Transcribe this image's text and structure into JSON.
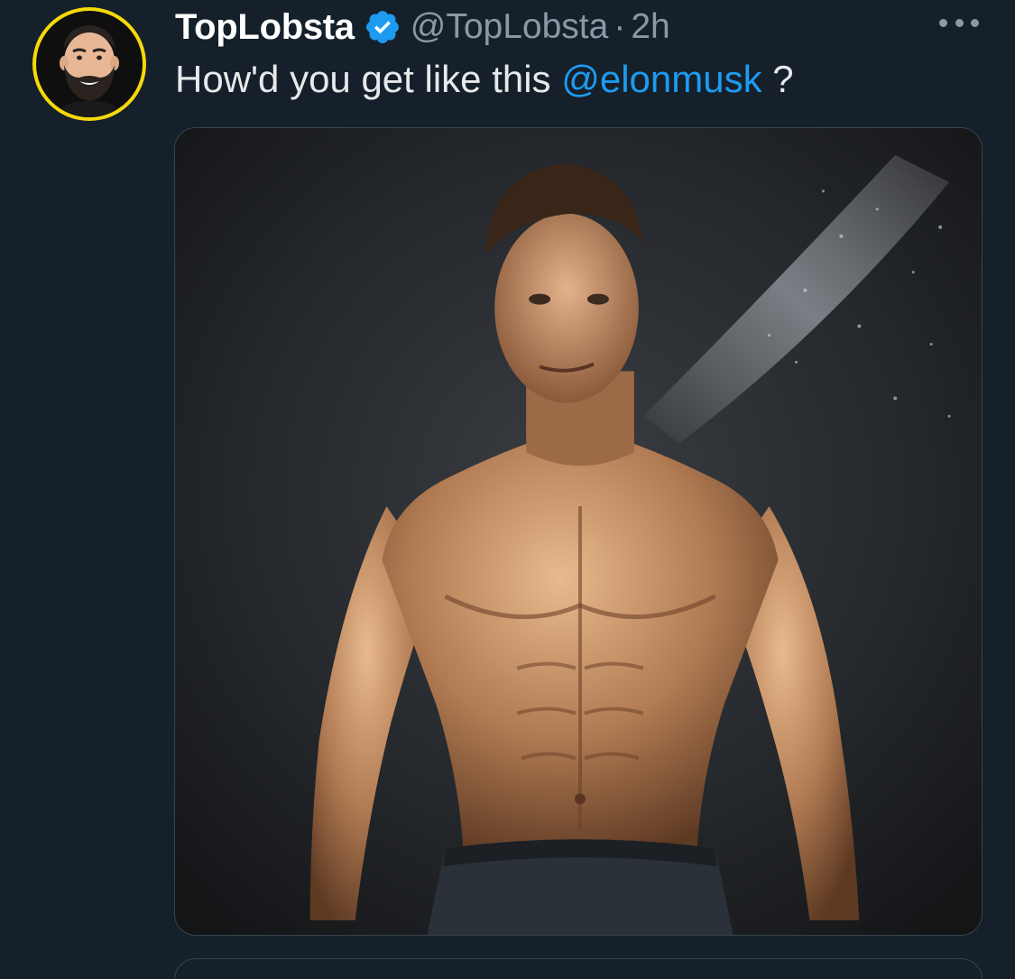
{
  "tweet": {
    "display_name": "TopLobsta",
    "handle": "@TopLobsta",
    "separator": "·",
    "time": "2h",
    "text_before": "How'd you get like this ",
    "mention": "@elonmusk",
    "text_after": " ?",
    "verified": true,
    "icons": {
      "verified": "verified-badge-icon",
      "more": "more-options-icon"
    }
  },
  "colors": {
    "background": "#15202b",
    "accent": "#1d9bf0",
    "secondary_text": "#8b98a5",
    "primary_text": "#e7e9ea",
    "avatar_ring": "#f5d90a"
  }
}
